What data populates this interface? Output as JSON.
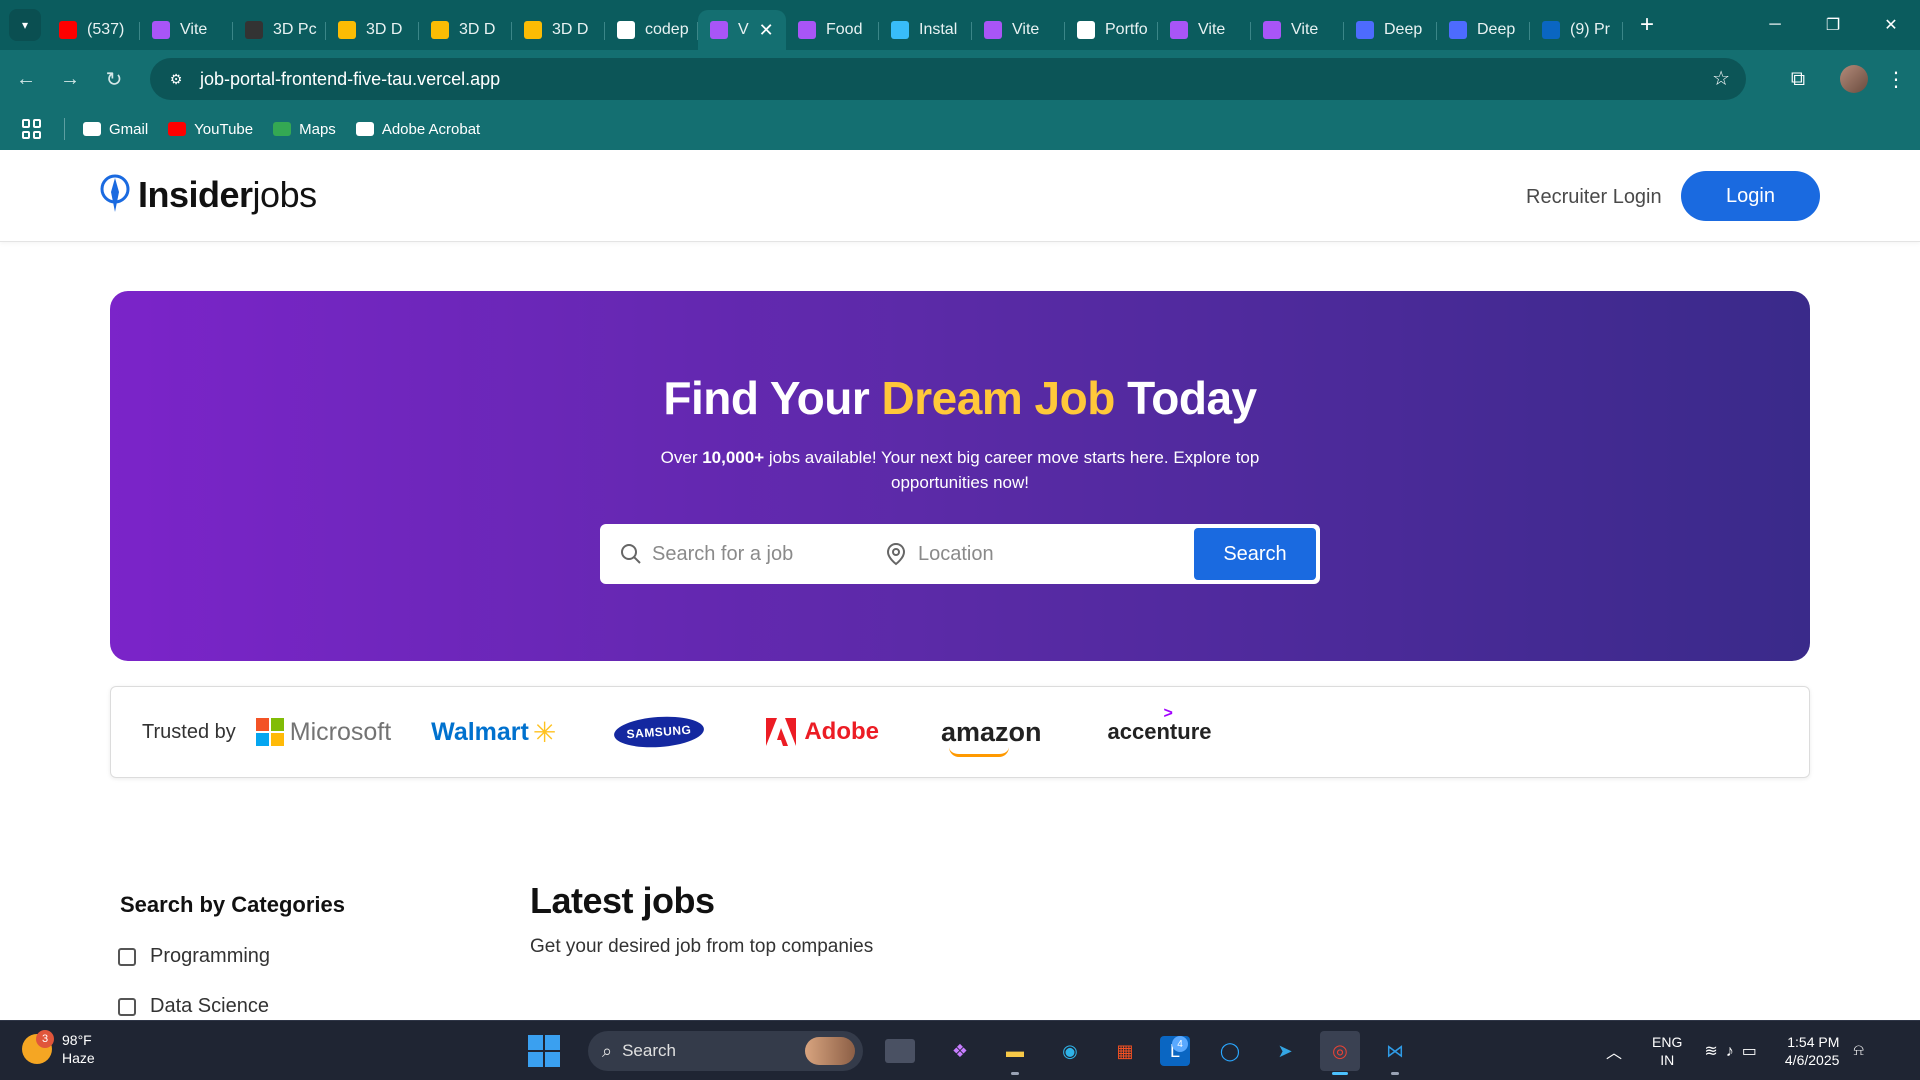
{
  "browser": {
    "tabs": [
      {
        "title": "(537)",
        "favicon": "youtube-icon",
        "color": "#ff0000"
      },
      {
        "title": "Vite",
        "favicon": "vite-icon",
        "color": "#a855f7"
      },
      {
        "title": "3D Pc",
        "favicon": "app-icon",
        "color": "#333333"
      },
      {
        "title": "3D D",
        "favicon": "drive-icon",
        "color": "#fbbc04"
      },
      {
        "title": "3D D",
        "favicon": "drive-icon",
        "color": "#fbbc04"
      },
      {
        "title": "3D D",
        "favicon": "drive-icon",
        "color": "#fbbc04"
      },
      {
        "title": "codep",
        "favicon": "github-icon",
        "color": "#ffffff"
      },
      {
        "title": "V",
        "favicon": "vite-icon",
        "color": "#a855f7",
        "active": true
      },
      {
        "title": "Food",
        "favicon": "vite-icon",
        "color": "#a855f7"
      },
      {
        "title": "Instal",
        "favicon": "tailwind-icon",
        "color": "#38bdf8"
      },
      {
        "title": "Vite",
        "favicon": "vite-icon",
        "color": "#a855f7"
      },
      {
        "title": "Portfo",
        "favicon": "globe-icon",
        "color": "#ffffff"
      },
      {
        "title": "Vite",
        "favicon": "vite-icon",
        "color": "#a855f7"
      },
      {
        "title": "Vite",
        "favicon": "vite-icon",
        "color": "#a855f7"
      },
      {
        "title": "Deep",
        "favicon": "deepseek-icon",
        "color": "#4d6bfe"
      },
      {
        "title": "Deep",
        "favicon": "deepseek-icon",
        "color": "#4d6bfe"
      },
      {
        "title": "(9) Pr",
        "favicon": "linkedin-icon",
        "color": "#0a66c2"
      }
    ],
    "url": "job-portal-frontend-five-tau.vercel.app",
    "bookmarks": [
      {
        "label": "Gmail",
        "icon": "gmail-icon"
      },
      {
        "label": "YouTube",
        "icon": "youtube-icon"
      },
      {
        "label": "Maps",
        "icon": "maps-icon"
      },
      {
        "label": "Adobe Acrobat",
        "icon": "acrobat-icon"
      }
    ]
  },
  "site": {
    "logo": {
      "bold": "Insider",
      "light": "jobs"
    },
    "nav": {
      "recruiter_login": "Recruiter Login",
      "login": "Login"
    },
    "hero": {
      "title_pre": "Find Your ",
      "title_highlight": "Dream Job",
      "title_post": " Today",
      "sub_pre": "Over ",
      "sub_bold": "10,000+",
      "sub_post": " jobs available! Your next big career move starts here. Explore top opportunities now!",
      "search_placeholder": "Search for a job",
      "location_placeholder": "Location",
      "search_button": "Search"
    },
    "trusted": {
      "label": "Trusted by",
      "brands": [
        "Microsoft",
        "Walmart",
        "SAMSUNG",
        "Adobe",
        "amazon",
        "accenture"
      ]
    },
    "categories": {
      "title": "Search by Categories",
      "items": [
        "Programming",
        "Data Science"
      ]
    },
    "latest": {
      "title": "Latest jobs",
      "subtitle": "Get your desired job from top companies"
    }
  },
  "taskbar": {
    "weather": {
      "temp": "98°F",
      "condition": "Haze",
      "badge": "3"
    },
    "search_label": "Search",
    "badge_count": "4",
    "lang": {
      "line1": "ENG",
      "line2": "IN"
    },
    "time": "1:54 PM",
    "date": "4/6/2025"
  },
  "colors": {
    "accent": "#1a6ae0",
    "highlight": "#ffc83a",
    "chrome": "#146f71"
  }
}
